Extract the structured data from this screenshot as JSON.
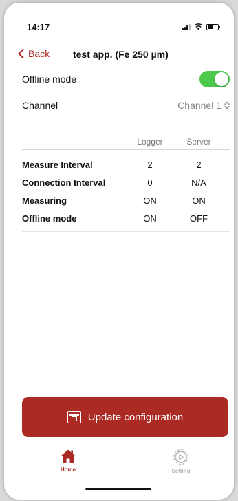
{
  "status_bar": {
    "time": "14:17"
  },
  "nav": {
    "back_label": "Back",
    "title": "test app. (Fe 250 µm)"
  },
  "settings": {
    "offline_mode": {
      "label": "Offline mode",
      "on": true
    },
    "channel": {
      "label": "Channel",
      "selected": "Channel 1"
    }
  },
  "table": {
    "headers": {
      "logger": "Logger",
      "server": "Server"
    },
    "rows": [
      {
        "label": "Measure Interval",
        "logger": "2",
        "server": "2"
      },
      {
        "label": "Connection Interval",
        "logger": "0",
        "server": "N/A"
      },
      {
        "label": "Measuring",
        "logger": "ON",
        "server": "ON"
      },
      {
        "label": "Offline mode",
        "logger": "ON",
        "server": "OFF"
      }
    ]
  },
  "actions": {
    "update_label": "Update configuration"
  },
  "tabs": [
    {
      "label": "Home",
      "icon": "home-icon",
      "active": true
    },
    {
      "label": "Setting",
      "icon": "gear-icon",
      "active": false
    }
  ],
  "colors": {
    "accent": "#ab2a24",
    "toggle_on": "#4cc94a",
    "muted": "#888888"
  }
}
